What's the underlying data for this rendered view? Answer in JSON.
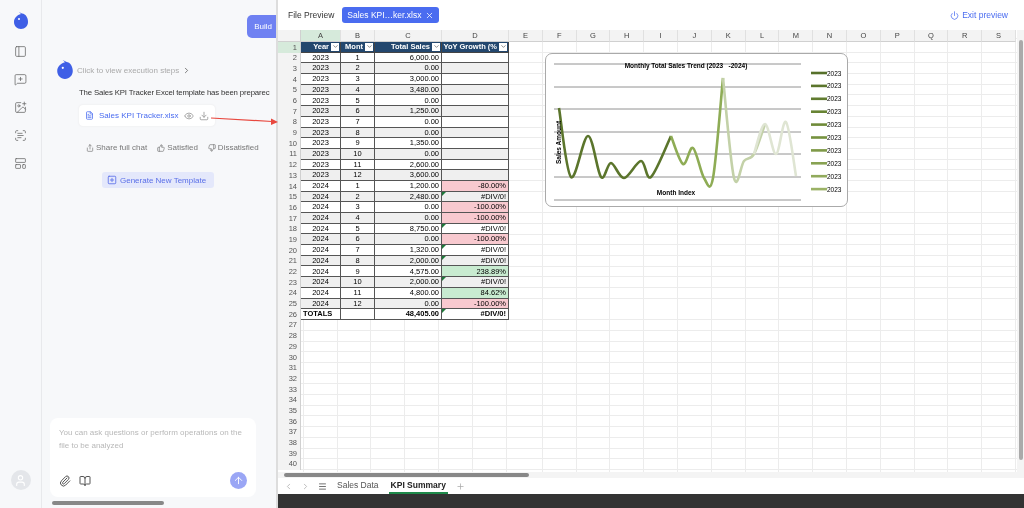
{
  "chat": {
    "build_button": "Build",
    "steps_link": "Click to view execution steps",
    "message": "The Sales KPI Tracker Excel template has been preparec",
    "file": {
      "name": "Sales KPI Tracker.xlsx"
    },
    "actions": [
      "Share full chat",
      "Satisfied",
      "Dissatisfied"
    ],
    "generate_button": "Generate New Template",
    "input": {
      "placeholder": "You can ask questions or perform operations on the file to be analyzed"
    }
  },
  "preview": {
    "title": "File Preview",
    "tabs": [
      {
        "label": "Sales KPI…ker.xlsx",
        "selected": true
      }
    ],
    "exit_button": "Exit preview"
  },
  "sheet": {
    "columns": [
      "A",
      "B",
      "C",
      "D",
      "E",
      "F",
      "G",
      "H",
      "I",
      "J",
      "K",
      "L",
      "M",
      "N",
      "O",
      "P",
      "Q",
      "R",
      "S"
    ],
    "row_numbers": [
      "1",
      "2",
      "3",
      "4",
      "5",
      "6",
      "7",
      "8",
      "9",
      "10",
      "11",
      "12",
      "13",
      "14",
      "15",
      "16",
      "17",
      "18",
      "19",
      "20",
      "21",
      "22",
      "23",
      "24",
      "25",
      "26",
      "27",
      "28",
      "29",
      "30",
      "31",
      "32",
      "33",
      "34",
      "35",
      "36",
      "37",
      "38",
      "39",
      "40"
    ],
    "header": [
      "Year",
      "Mont",
      "Total Sales",
      "YoY Growth (%"
    ],
    "rows": [
      {
        "kind": "data",
        "cells": [
          "2023",
          "1",
          "6,000.00",
          ""
        ],
        "flag": false
      },
      {
        "kind": "data",
        "cells": [
          "2023",
          "2",
          "0.00",
          ""
        ],
        "flag": false
      },
      {
        "kind": "data",
        "cells": [
          "2023",
          "3",
          "3,000.00",
          ""
        ],
        "flag": false
      },
      {
        "kind": "data",
        "cells": [
          "2023",
          "4",
          "3,480.00",
          ""
        ],
        "flag": false
      },
      {
        "kind": "data",
        "cells": [
          "2023",
          "5",
          "0.00",
          ""
        ],
        "flag": false
      },
      {
        "kind": "data",
        "cells": [
          "2023",
          "6",
          "1,250.00",
          ""
        ],
        "flag": false
      },
      {
        "kind": "data",
        "cells": [
          "2023",
          "7",
          "0.00",
          ""
        ],
        "flag": false
      },
      {
        "kind": "data",
        "cells": [
          "2023",
          "8",
          "0.00",
          ""
        ],
        "flag": false
      },
      {
        "kind": "data",
        "cells": [
          "2023",
          "9",
          "1,350.00",
          ""
        ],
        "flag": false
      },
      {
        "kind": "data",
        "cells": [
          "2023",
          "10",
          "0.00",
          ""
        ],
        "flag": false
      },
      {
        "kind": "data",
        "cells": [
          "2023",
          "11",
          "2,600.00",
          ""
        ],
        "flag": false
      },
      {
        "kind": "data",
        "cells": [
          "2023",
          "12",
          "3,600.00",
          ""
        ],
        "flag": false
      },
      {
        "kind": "data",
        "cells": [
          "2024",
          "1",
          "1,200.00",
          "-80.00%"
        ],
        "color": "#f8c9cf",
        "flag": false
      },
      {
        "kind": "data",
        "cells": [
          "2024",
          "2",
          "2,480.00",
          "#DIV/0!"
        ],
        "flag": true
      },
      {
        "kind": "data",
        "cells": [
          "2024",
          "3",
          "0.00",
          "-100.00%"
        ],
        "color": "#f8c9cf",
        "flag": false
      },
      {
        "kind": "data",
        "cells": [
          "2024",
          "4",
          "0.00",
          "-100.00%"
        ],
        "color": "#f8c9cf",
        "flag": false
      },
      {
        "kind": "data",
        "cells": [
          "2024",
          "5",
          "8,750.00",
          "#DIV/0!"
        ],
        "flag": true
      },
      {
        "kind": "data",
        "cells": [
          "2024",
          "6",
          "0.00",
          "-100.00%"
        ],
        "color": "#f8c9cf",
        "flag": false
      },
      {
        "kind": "data",
        "cells": [
          "2024",
          "7",
          "1,320.00",
          "#DIV/0!"
        ],
        "flag": true
      },
      {
        "kind": "data",
        "cells": [
          "2024",
          "8",
          "2,000.00",
          "#DIV/0!"
        ],
        "flag": true
      },
      {
        "kind": "data",
        "cells": [
          "2024",
          "9",
          "4,575.00",
          "238.89%"
        ],
        "color": "#c8ebd0",
        "flag": false
      },
      {
        "kind": "data",
        "cells": [
          "2024",
          "10",
          "2,000.00",
          "#DIV/0!"
        ],
        "flag": true
      },
      {
        "kind": "data",
        "cells": [
          "2024",
          "11",
          "4,800.00",
          "84.62%"
        ],
        "color": "#c8ebd0",
        "flag": false
      },
      {
        "kind": "data",
        "cells": [
          "2024",
          "12",
          "0.00",
          "-100.00%"
        ],
        "color": "#f8c9cf",
        "flag": false
      },
      {
        "kind": "total",
        "cells": [
          "TOTALS",
          "",
          "48,405.00",
          "#DIV/0!"
        ],
        "flag": true
      }
    ]
  },
  "chart": {
    "title": "Monthly Total Sales Trend (2023   -2024)",
    "ylabel": "Sales Amount",
    "xlabel": "Month Index",
    "legend": [
      {
        "label": "2023",
        "color": "#56702a"
      },
      {
        "label": "2023",
        "color": "#5b752c"
      },
      {
        "label": "2023",
        "color": "#617c30"
      },
      {
        "label": "2023",
        "color": "#688434"
      },
      {
        "label": "2023",
        "color": "#6f8b39"
      },
      {
        "label": "2023",
        "color": "#76923f"
      },
      {
        "label": "2023",
        "color": "#7f9a48"
      },
      {
        "label": "2023",
        "color": "#88a252"
      },
      {
        "label": "2023",
        "color": "#91aa5c"
      },
      {
        "label": "2023",
        "color": "#9bb266"
      }
    ]
  },
  "sheet_tabs": [
    {
      "label": "Sales Data",
      "selected": false
    },
    {
      "label": "KPI Summary",
      "selected": true
    }
  ]
}
